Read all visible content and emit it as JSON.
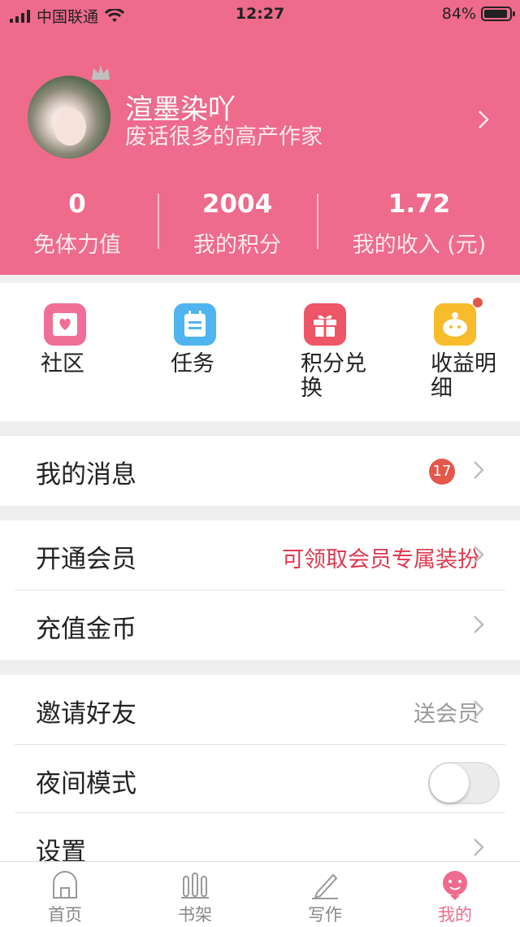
{
  "status_bar": {
    "carrier": "中国联通",
    "time": "12:27",
    "battery": "84%"
  },
  "profile": {
    "name": "渲墨染吖",
    "bio": "废话很多的高产作家"
  },
  "stats": [
    {
      "value": "0",
      "label": "免体力值"
    },
    {
      "value": "2004",
      "label": "我的积分"
    },
    {
      "value": "1.72",
      "label": "我的收入 (元)"
    }
  ],
  "shortcuts": [
    {
      "label": "社区",
      "icon": "community-icon",
      "color": "#f06f96"
    },
    {
      "label": "任务",
      "icon": "task-icon",
      "color": "#4fb4ef"
    },
    {
      "label": "积分兑换",
      "icon": "gift-icon",
      "color": "#ee5566"
    },
    {
      "label": "收益明细",
      "icon": "piggy-bank-icon",
      "color": "#f7bb2b"
    }
  ],
  "menu": {
    "messages": {
      "label": "我的消息",
      "badge": "17"
    },
    "vip": {
      "label": "开通会员",
      "hint": "可领取会员专属装扮"
    },
    "recharge": {
      "label": "充值金币"
    },
    "invite": {
      "label": "邀请好友",
      "hint": "送会员"
    },
    "night_mode": {
      "label": "夜间模式",
      "enabled": false
    },
    "settings": {
      "label": "设置"
    }
  },
  "tabs": [
    {
      "label": "首页",
      "icon": "home-icon"
    },
    {
      "label": "书架",
      "icon": "bookshelf-icon"
    },
    {
      "label": "写作",
      "icon": "pen-icon"
    },
    {
      "label": "我的",
      "icon": "profile-icon",
      "active": true
    }
  ],
  "colors": {
    "brand": "#ee6b8b",
    "highlight_text": "#e0394f",
    "badge": "#e4574b"
  }
}
